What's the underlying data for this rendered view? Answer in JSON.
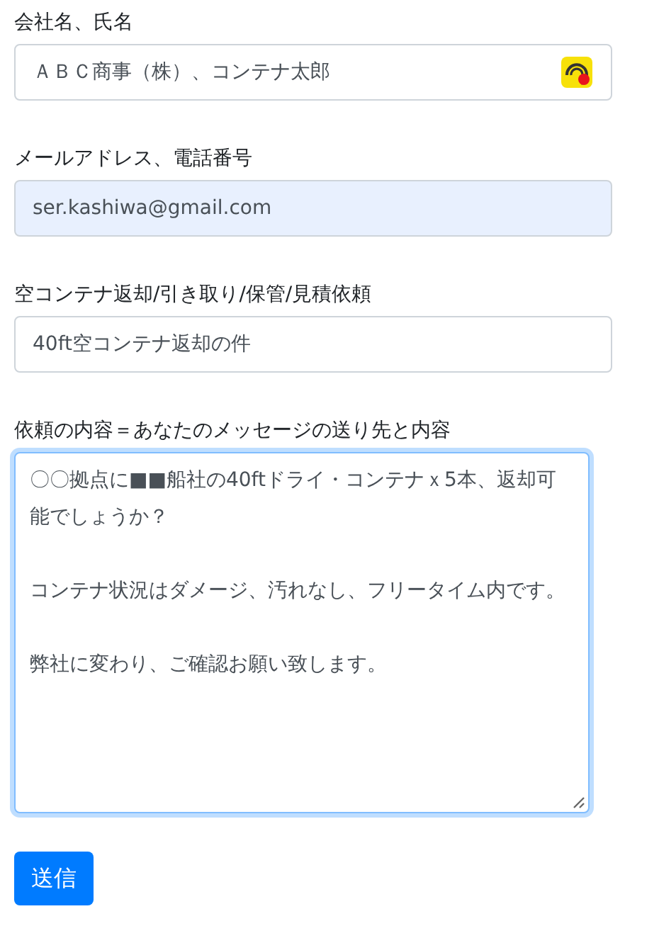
{
  "form": {
    "fields": [
      {
        "kind": "text",
        "label": "会社名、氏名",
        "value": "ＡＢＣ商事（株）、コンテナ太郎",
        "autofilled": false,
        "focused": false,
        "has_extension_icon": true
      },
      {
        "kind": "text",
        "label": "メールアドレス、電話番号",
        "value": "ser.kashiwa@gmail.com",
        "autofilled": true,
        "focused": false,
        "has_extension_icon": false
      },
      {
        "kind": "text",
        "label": "空コンテナ返却/引き取り/保管/見積依頼",
        "value": "40ft空コンテナ返却の件",
        "autofilled": false,
        "focused": false,
        "has_extension_icon": false
      },
      {
        "kind": "textarea",
        "label": "依頼の内容＝あなたのメッセージの送り先と内容",
        "paragraphs": [
          "〇〇拠点に■■船社の40ftドライ・コンテナｘ5本、返却可能でしょうか？",
          "コンテナ状況はダメージ、汚れなし、フリータイム内です。",
          "弊社に変わり、ご確認お願い致します。"
        ],
        "autofilled": false,
        "focused": true,
        "has_extension_icon": false
      }
    ],
    "submit": {
      "label": "送信"
    }
  }
}
